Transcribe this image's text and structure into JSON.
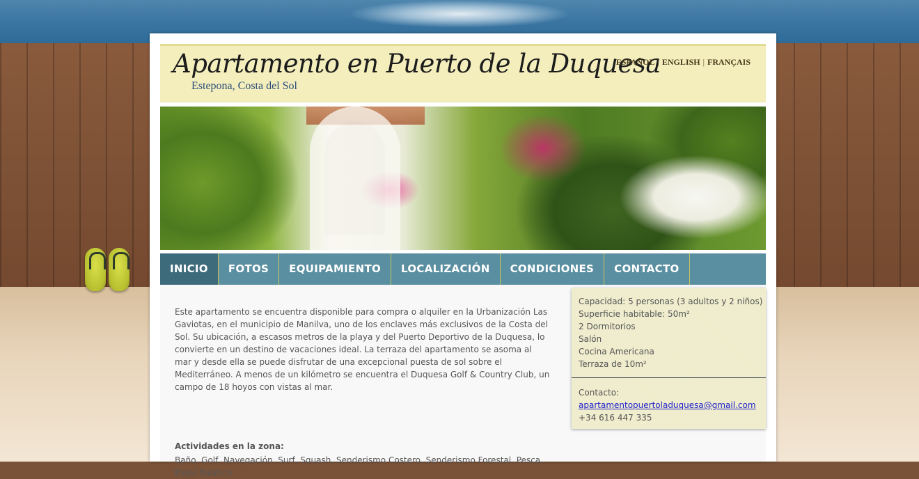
{
  "site": {
    "title": "Apartamento en Puerto de la Duquesa",
    "subtitle": "Estepona, Costa del Sol"
  },
  "languages": [
    {
      "label": "ESPAÑOL"
    },
    {
      "label": "ENGLISH"
    },
    {
      "label": "FRANÇAIS"
    }
  ],
  "language_separator": "|",
  "nav": {
    "items": [
      {
        "label": "INICIO",
        "active": true
      },
      {
        "label": "FOTOS"
      },
      {
        "label": "EQUIPAMIENTO"
      },
      {
        "label": "LOCALIZACIÓN"
      },
      {
        "label": "CONDICIONES"
      },
      {
        "label": "CONTACTO"
      }
    ]
  },
  "main": {
    "intro": "Este apartamento se encuentra disponible para compra o alquiler en la Urbanización Las Gaviotas, en el municipio de Manilva, uno de los enclaves más exclusivos de la Costa del Sol. Su ubicación, a escasos metros de la playa y del Puerto Deportivo de la Duquesa, lo convierte en un destino de vacaciones ideal. La terraza del apartamento se asoma al mar y desde ella se puede disfrutar de una excepcional puesta de sol sobre el Mediterráneo. A menos de un kilómetro se encuentra el Duquesa Golf & Country Club, un campo de 18 hoyos con vistas al mar.",
    "activities_title": "Actividades en la zona:",
    "activities": "Baño, Golf, Navegación, Surf, Squash, Senderismo Costero, Senderismo Forestal, Pesca, Esquí Naútico."
  },
  "sidebar": {
    "specs": [
      "Capacidad: 5 personas (3 adultos y 2 niños)",
      "Superficie habitable: 50m²",
      "2 Dormitorios",
      "Salón",
      "Cocina Americana",
      "Terraza de 10m²"
    ],
    "contact_label": "Contacto:",
    "email": "apartamentopuertoladuquesa@gmail.com",
    "phone": "+34 616 447 335"
  },
  "colors": {
    "header_bg": "#f3eebc",
    "nav_bg": "#5a8fa1",
    "nav_active_bg": "#3e6b7b",
    "nav_separator": "#cbc65a",
    "sidebar_bg": "#eeeccb",
    "link": "#2222cc"
  }
}
